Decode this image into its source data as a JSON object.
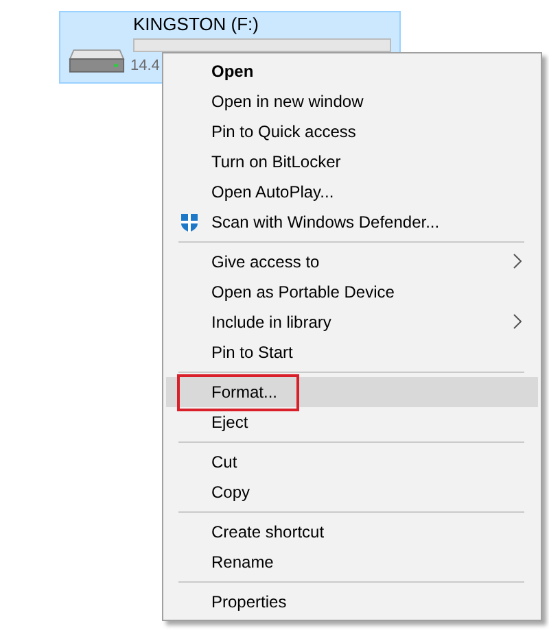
{
  "drive": {
    "name": "KINGSTON (F:)",
    "level": 0,
    "size_text": "14.4",
    "selected": true
  },
  "context_menu": {
    "items": [
      {
        "kind": "item",
        "label": "Open",
        "default": true,
        "icon": false,
        "submenu": false,
        "selected": false,
        "outlined": false
      },
      {
        "kind": "item",
        "label": "Open in new window",
        "default": false,
        "icon": false,
        "submenu": false,
        "selected": false,
        "outlined": false
      },
      {
        "kind": "item",
        "label": "Pin to Quick access",
        "default": false,
        "icon": false,
        "submenu": false,
        "selected": false,
        "outlined": false
      },
      {
        "kind": "item",
        "label": "Turn on BitLocker",
        "default": false,
        "icon": false,
        "submenu": false,
        "selected": false,
        "outlined": false
      },
      {
        "kind": "item",
        "label": "Open AutoPlay...",
        "default": false,
        "icon": false,
        "submenu": false,
        "selected": false,
        "outlined": false
      },
      {
        "kind": "item",
        "label": "Scan with Windows Defender...",
        "default": false,
        "icon": true,
        "submenu": false,
        "selected": false,
        "outlined": false
      },
      {
        "kind": "separator"
      },
      {
        "kind": "item",
        "label": "Give access to",
        "default": false,
        "icon": false,
        "submenu": true,
        "selected": false,
        "outlined": false
      },
      {
        "kind": "item",
        "label": "Open as Portable Device",
        "default": false,
        "icon": false,
        "submenu": false,
        "selected": false,
        "outlined": false
      },
      {
        "kind": "item",
        "label": "Include in library",
        "default": false,
        "icon": false,
        "submenu": true,
        "selected": false,
        "outlined": false
      },
      {
        "kind": "item",
        "label": "Pin to Start",
        "default": false,
        "icon": false,
        "submenu": false,
        "selected": false,
        "outlined": false
      },
      {
        "kind": "separator"
      },
      {
        "kind": "item",
        "label": "Format...",
        "default": false,
        "icon": false,
        "submenu": false,
        "selected": true,
        "outlined": true
      },
      {
        "kind": "item",
        "label": "Eject",
        "default": false,
        "icon": false,
        "submenu": false,
        "selected": false,
        "outlined": false
      },
      {
        "kind": "separator"
      },
      {
        "kind": "item",
        "label": "Cut",
        "default": false,
        "icon": false,
        "submenu": false,
        "selected": false,
        "outlined": false
      },
      {
        "kind": "item",
        "label": "Copy",
        "default": false,
        "icon": false,
        "submenu": false,
        "selected": false,
        "outlined": false
      },
      {
        "kind": "separator"
      },
      {
        "kind": "item",
        "label": "Create shortcut",
        "default": false,
        "icon": false,
        "submenu": false,
        "selected": false,
        "outlined": false
      },
      {
        "kind": "item",
        "label": "Rename",
        "default": false,
        "icon": false,
        "submenu": false,
        "selected": false,
        "outlined": false
      },
      {
        "kind": "separator"
      },
      {
        "kind": "item",
        "label": "Properties",
        "default": false,
        "icon": false,
        "submenu": false,
        "selected": false,
        "outlined": false
      }
    ]
  }
}
